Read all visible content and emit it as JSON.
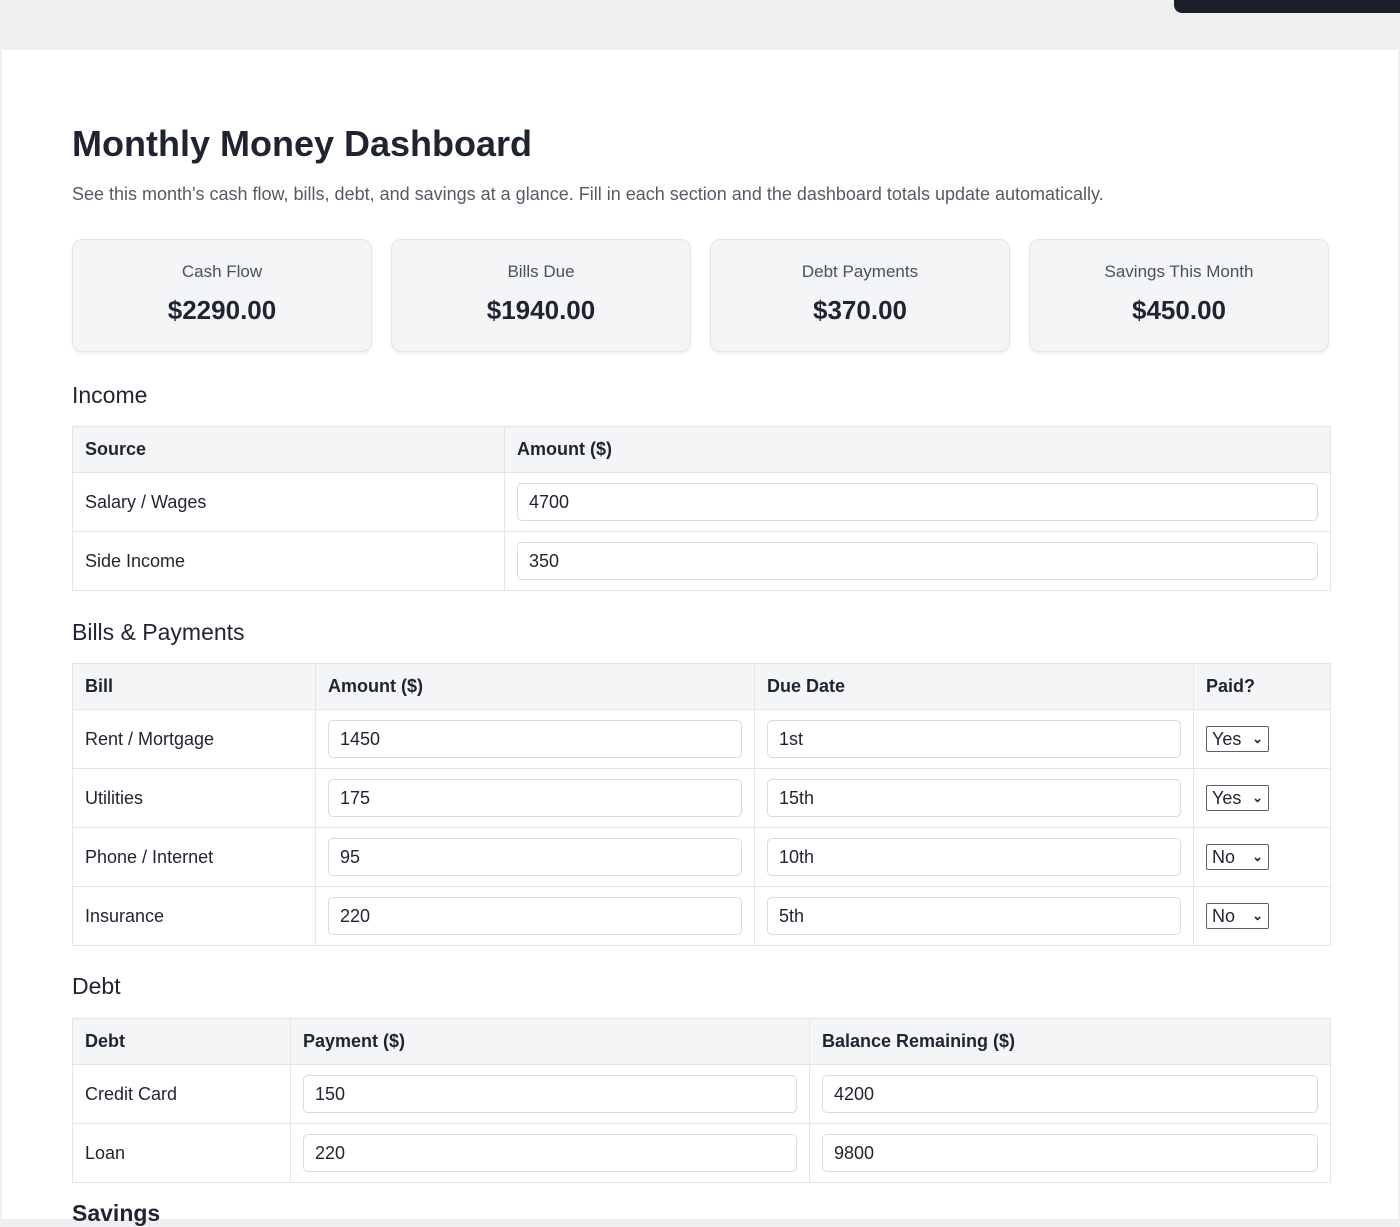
{
  "header": {
    "title": "Monthly Money Dashboard",
    "subtitle": "See this month's cash flow, bills, debt, and savings at a glance. Fill in each section and the dashboard totals update automatically."
  },
  "summary_cards": [
    {
      "label": "Cash Flow",
      "value": "$2290.00"
    },
    {
      "label": "Bills Due",
      "value": "$1940.00"
    },
    {
      "label": "Debt Payments",
      "value": "$370.00"
    },
    {
      "label": "Savings This Month",
      "value": "$450.00"
    }
  ],
  "income": {
    "title": "Income",
    "columns": [
      "Source",
      "Amount ($)"
    ],
    "rows": [
      {
        "source": "Salary / Wages",
        "amount": "4700"
      },
      {
        "source": "Side Income",
        "amount": "350"
      }
    ]
  },
  "bills": {
    "title": "Bills & Payments",
    "columns": [
      "Bill",
      "Amount ($)",
      "Due Date",
      "Paid?"
    ],
    "rows": [
      {
        "bill": "Rent / Mortgage",
        "amount": "1450",
        "due": "1st",
        "paid": "Yes"
      },
      {
        "bill": "Utilities",
        "amount": "175",
        "due": "15th",
        "paid": "Yes"
      },
      {
        "bill": "Phone / Internet",
        "amount": "95",
        "due": "10th",
        "paid": "No"
      },
      {
        "bill": "Insurance",
        "amount": "220",
        "due": "5th",
        "paid": "No"
      }
    ]
  },
  "debt": {
    "title": "Debt",
    "columns": [
      "Debt",
      "Payment ($)",
      "Balance Remaining ($)"
    ],
    "rows": [
      {
        "debt": "Credit Card",
        "payment": "150",
        "balance": "4200"
      },
      {
        "debt": "Loan",
        "payment": "220",
        "balance": "9800"
      }
    ]
  },
  "next_section": {
    "title": "Savings"
  }
}
